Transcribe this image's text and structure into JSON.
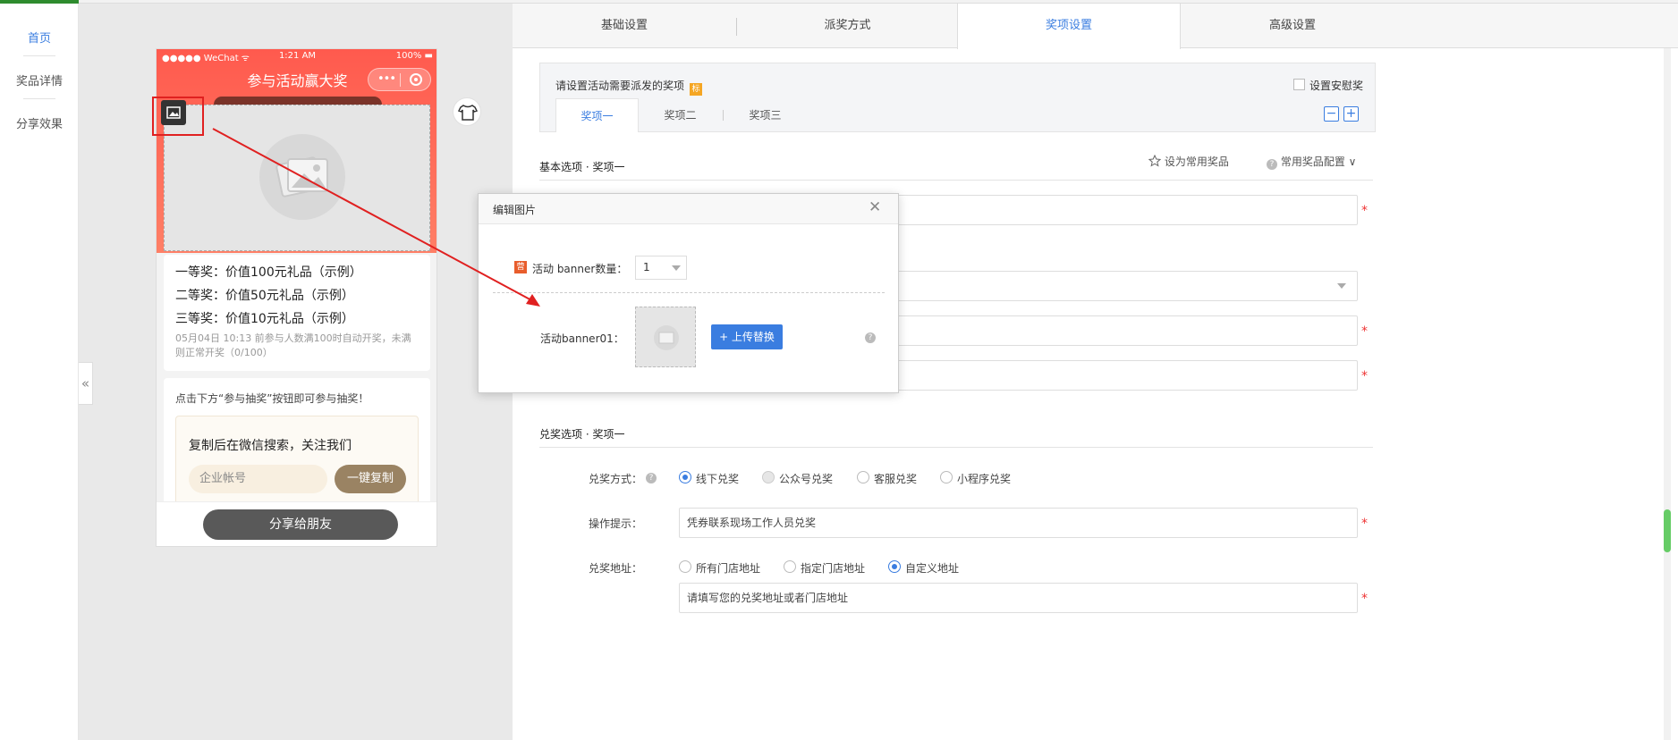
{
  "nav": {
    "items": [
      {
        "label": "首页",
        "active": true
      },
      {
        "label": "奖品详情",
        "active": false
      },
      {
        "label": "分享效果",
        "active": false
      }
    ],
    "collapse_label": "«"
  },
  "phone": {
    "status_left": "●●●●● WeChat ᯤ",
    "status_time": "1:21 AM",
    "status_right": "100% ▬",
    "title": "参与活动赢大奖",
    "capsule_dots": "•••",
    "prizes": [
      "一等奖：价值100元礼品（示例）",
      "二等奖：价值50元礼品（示例）",
      "三等奖：价值10元礼品（示例）"
    ],
    "draw_note": "05月04日 10:13 前参与人数满100时自动开奖，未满则正常开奖（0/100）",
    "tip": "点击下方“参与抽奖”按钮即可参与抽奖！",
    "copy_title": "复制后在微信搜索，关注我们",
    "copy_input": "企业帐号",
    "copy_button": "一键复制",
    "share_button": "分享给朋友"
  },
  "tabs": [
    {
      "label": "基础设置",
      "active": false
    },
    {
      "label": "派奖方式",
      "active": false
    },
    {
      "label": "奖项设置",
      "active": true
    },
    {
      "label": "高级设置",
      "active": false
    }
  ],
  "prize_box": {
    "title": "请设置活动需要派发的奖项",
    "tag": "标",
    "consolation_label": "设置安慰奖",
    "subtabs": [
      {
        "label": "奖项一",
        "active": true
      },
      {
        "label": "奖项二",
        "active": false
      },
      {
        "label": "奖项三",
        "active": false
      }
    ],
    "minus": "−",
    "plus": "+"
  },
  "basic": {
    "heading": "基本选项 · 奖项一",
    "fav_label": "设为常用奖品",
    "fav_config": "常用奖品配置 ∨"
  },
  "redeem": {
    "heading": "兑奖选项 · 奖项一",
    "method_label": "兑奖方式：",
    "methods": [
      {
        "label": "线下兑奖",
        "state": "on"
      },
      {
        "label": "公众号兑奖",
        "state": "disabled"
      },
      {
        "label": "客服兑奖",
        "state": "off"
      },
      {
        "label": "小程序兑奖",
        "state": "off"
      }
    ],
    "hint_label": "操作提示：",
    "hint_value": "凭券联系现场工作人员兑奖",
    "address_label": "兑奖地址：",
    "address_options": [
      {
        "label": "所有门店地址",
        "state": "off"
      },
      {
        "label": "指定门店地址",
        "state": "off"
      },
      {
        "label": "自定义地址",
        "state": "on"
      }
    ],
    "address_placeholder": "请填写您的兑奖地址或者门店地址"
  },
  "modal": {
    "title": "编辑图片",
    "close": "✕",
    "tag": "营",
    "count_label": "活动 banner数量：",
    "count_value": "1",
    "banner_label": "活动banner01：",
    "upload_button": "+ 上传替换",
    "help": "?"
  },
  "colors": {
    "accent": "#3a7de0",
    "phone_header": "#ff5a4e",
    "annotation": "#e02020"
  }
}
